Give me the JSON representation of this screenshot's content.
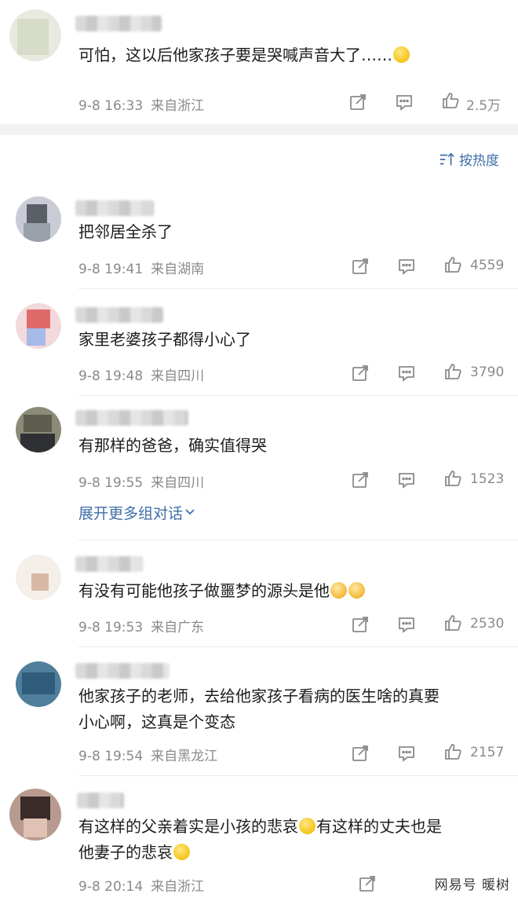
{
  "top_comment": {
    "text": "可怕，这以后他家孩子要是哭喊声音大了……",
    "date": "9-8 16:33",
    "location": "来自浙江",
    "likes": "2.5万"
  },
  "sort": {
    "label": "按热度"
  },
  "comments": [
    {
      "text": "把邻居全杀了",
      "date": "9-8 19:41",
      "location": "来自湖南",
      "likes": "4559"
    },
    {
      "text": "家里老婆孩子都得小心了",
      "date": "9-8 19:48",
      "location": "来自四川",
      "likes": "3790"
    },
    {
      "text": "有那样的爸爸，确实值得哭",
      "date": "9-8 19:55",
      "location": "来自四川",
      "likes": "1523",
      "expand": "展开更多组对话"
    },
    {
      "text": "有没有可能他孩子做噩梦的源头是他",
      "date": "9-8 19:53",
      "location": "来自广东",
      "likes": "2530"
    },
    {
      "text_line1": "他家孩子的老师，去给他家孩子看病的医生啥的真要",
      "text_line2": "小心啊，这真是个变态",
      "date": "9-8 19:54",
      "location": "来自黑龙江",
      "likes": "2157"
    },
    {
      "text_line1": "有这样的父亲着实是小孩的悲哀",
      "text_line1b": "有这样的丈夫也是",
      "text_line2": "他妻子的悲哀",
      "date": "9-8 20:14",
      "location": "来自浙江",
      "likes": ""
    }
  ],
  "watermark": "网易号 暖树",
  "colors": {
    "link": "#3f6ea8",
    "meta": "#8a8a8a",
    "band": "#f2f2f2"
  }
}
